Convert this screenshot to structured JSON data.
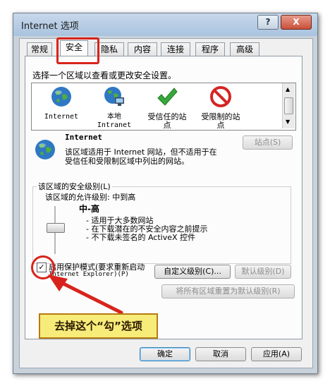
{
  "window": {
    "title": "Internet 选项"
  },
  "title_buttons": {
    "help": "?",
    "close": "X"
  },
  "tabs": [
    {
      "label": "常规",
      "active": false
    },
    {
      "label": "安全",
      "active": true
    },
    {
      "label": "隐私",
      "active": false
    },
    {
      "label": "内容",
      "active": false
    },
    {
      "label": "连接",
      "active": false
    },
    {
      "label": "程序",
      "active": false
    },
    {
      "label": "高级",
      "active": false
    }
  ],
  "security": {
    "select_zone_prompt": "选择一个区域以查看或更改安全设置。",
    "zones": [
      {
        "label": "Internet",
        "icon": "globe-icon"
      },
      {
        "label": "本地\nIntranet",
        "icon": "intranet-globe-icon"
      },
      {
        "label": "受信任的站\n点",
        "icon": "green-check-icon"
      },
      {
        "label": "受限制的站\n点",
        "icon": "restricted-icon"
      }
    ],
    "selected_zone": {
      "name": "Internet",
      "description_line1": "该区域适用于 Internet 网站，但不适用于在",
      "description_line2": "受信任和受限制区域中列出的网站。"
    },
    "sites_button": "站点(S)",
    "level_group_title": "该区域的安全级别(L)",
    "allowed_levels": "该区域的允许级别: 中到高",
    "level_name": "中-高",
    "level_points": [
      "- 适用于大多数网站",
      "- 在下载潜在的不安全内容之前提示",
      "- 不下载未签名的 ActiveX 控件"
    ],
    "protected_mode_label_line1": "启用保护模式(要求重新启动",
    "protected_mode_label_line2": "Internet Explorer)(P)",
    "protected_mode_checked": true,
    "custom_level_button": "自定义级别(C)...",
    "default_level_button": "默认级别(D)",
    "reset_all_button": "将所有区域重置为默认级别(R)"
  },
  "annotation": {
    "text": "去掉这个“勾”选项"
  },
  "footer": {
    "ok": "确定",
    "cancel": "取消",
    "apply": "应用(A)"
  },
  "colors": {
    "annotation_red": "#d8231c",
    "annotation_fill": "#f7ec7a"
  }
}
